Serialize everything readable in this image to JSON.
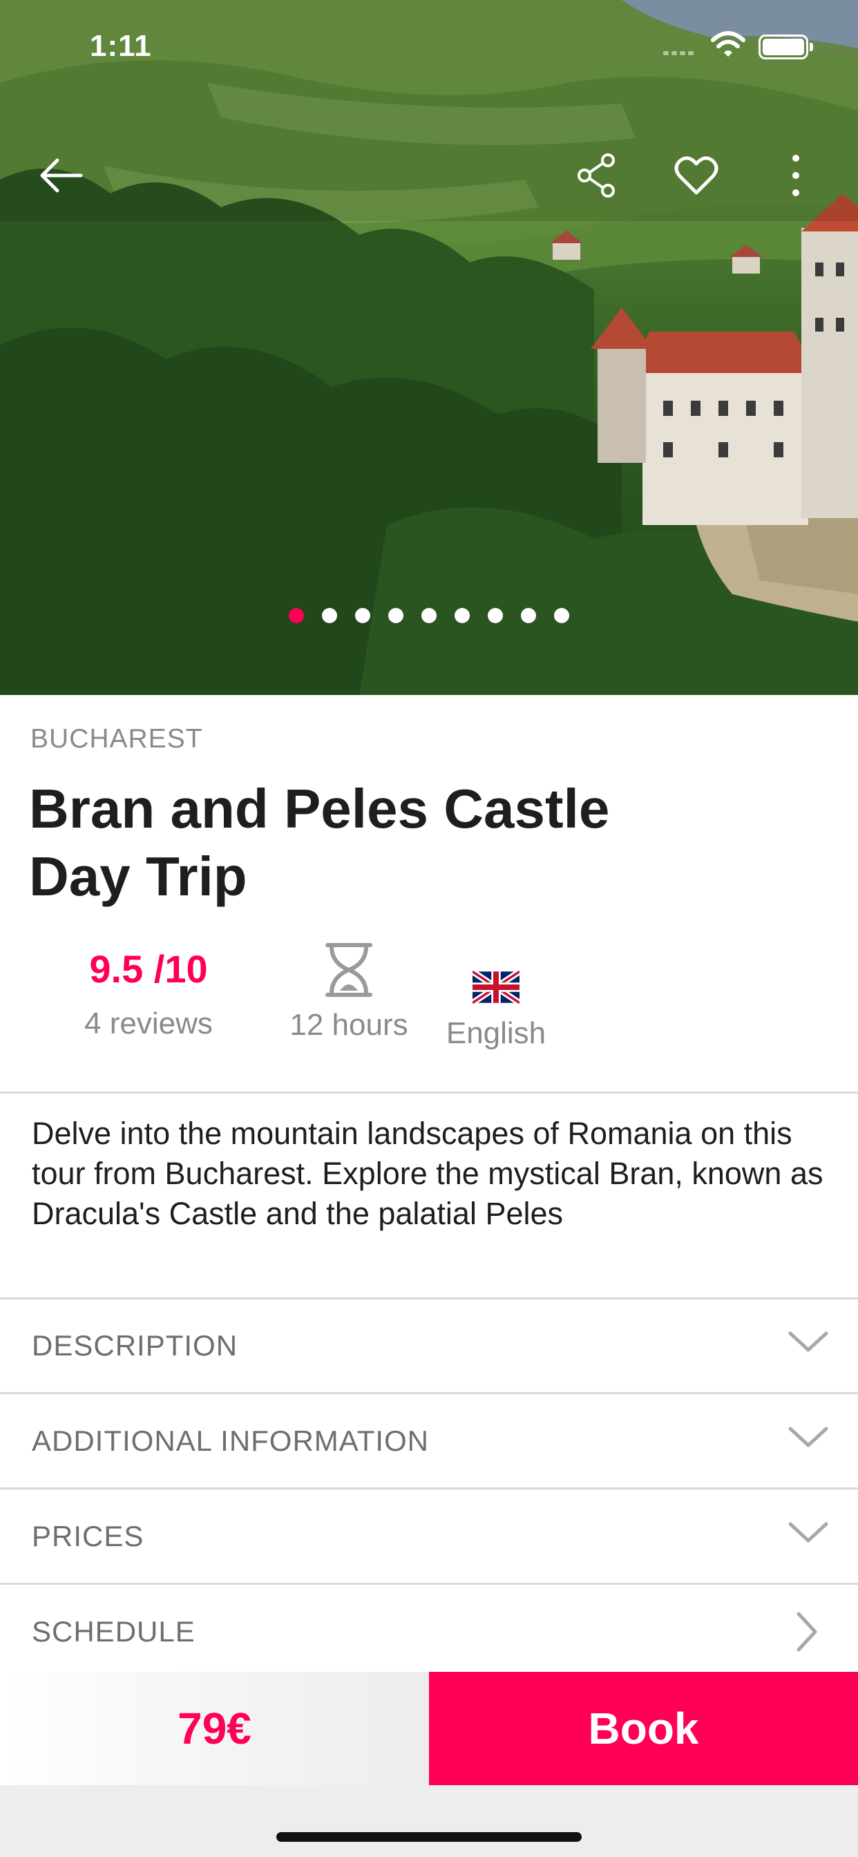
{
  "status_bar": {
    "time": "1:11"
  },
  "hero": {
    "image": "Landscape photo of green hills with Bran Castle",
    "carousel_count": 9,
    "carousel_active": 0
  },
  "actions": {
    "back": "back-arrow-icon",
    "share": "share-icon",
    "favorite": "heart-icon",
    "more": "more-vertical-icon"
  },
  "tour": {
    "city": "BUCHAREST",
    "title": "Bran and Peles Castle Day Trip",
    "rating": "9.5 /10",
    "reviews": "4 reviews",
    "duration": "12 hours",
    "language": "English",
    "summary": "Delve into the mountain landscapes of Romania on this tour from Bucharest. Explore the mystical Bran, known as Dracula's Castle and the palatial Peles"
  },
  "sections": [
    {
      "label": "DESCRIPTION",
      "icon": "chevron-down-icon"
    },
    {
      "label": "ADDITIONAL INFORMATION",
      "icon": "chevron-down-icon"
    },
    {
      "label": "PRICES",
      "icon": "chevron-down-icon"
    },
    {
      "label": "SCHEDULE",
      "icon": "chevron-right-icon"
    }
  ],
  "footer": {
    "price": "79€",
    "book_label": "Book"
  },
  "colors": {
    "accent": "#ff0055",
    "muted": "#8a8a8a",
    "divider": "#d9d9d9"
  }
}
